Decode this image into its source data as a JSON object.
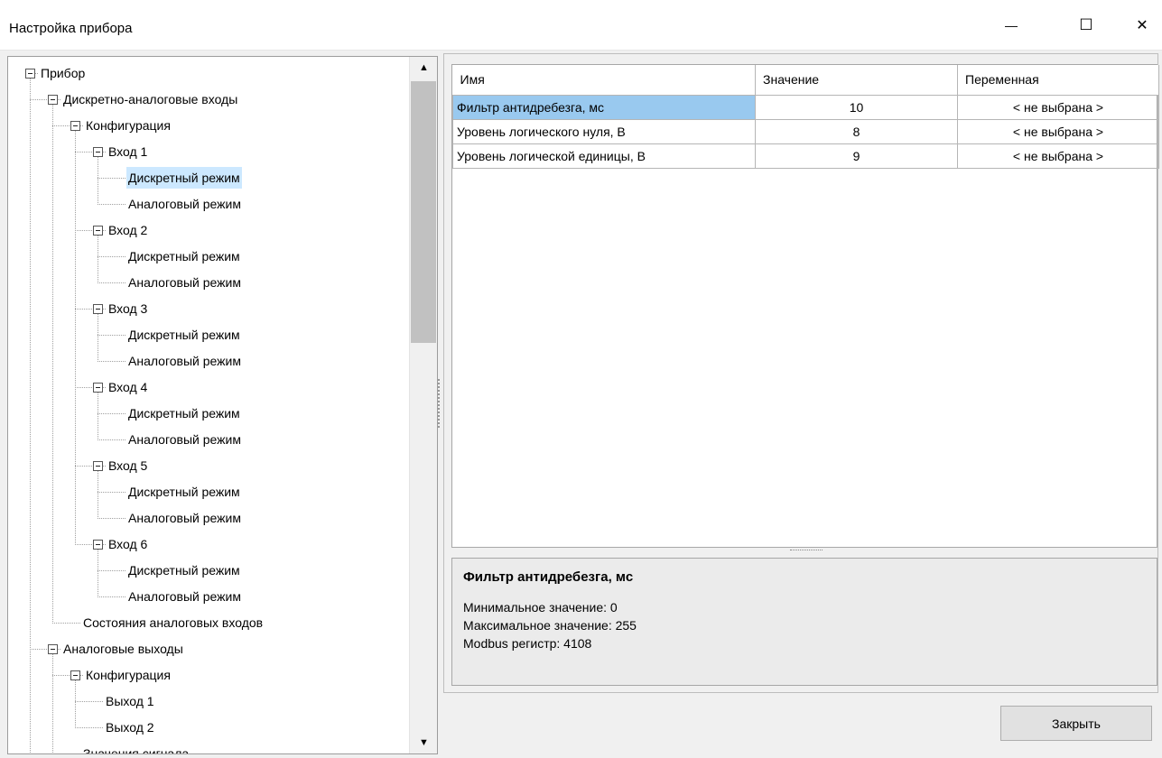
{
  "window": {
    "title": "Настройка прибора",
    "minimize_glyph": "—",
    "maximize_glyph": "☐",
    "close_glyph": "✕"
  },
  "tree": {
    "nodes": [
      {
        "label": "Прибор",
        "level": 0,
        "expanded": true
      },
      {
        "label": "Дискретно-аналоговые входы",
        "level": 1,
        "expanded": true
      },
      {
        "label": "Конфигурация",
        "level": 2,
        "expanded": true
      },
      {
        "label": "Вход 1",
        "level": 3,
        "expanded": true
      },
      {
        "label": "Дискретный режим",
        "level": 4,
        "selected": true
      },
      {
        "label": "Аналоговый режим",
        "level": 4
      },
      {
        "label": "Вход 2",
        "level": 3,
        "expanded": true
      },
      {
        "label": "Дискретный режим",
        "level": 4
      },
      {
        "label": "Аналоговый режим",
        "level": 4
      },
      {
        "label": "Вход 3",
        "level": 3,
        "expanded": true
      },
      {
        "label": "Дискретный режим",
        "level": 4
      },
      {
        "label": "Аналоговый режим",
        "level": 4
      },
      {
        "label": "Вход 4",
        "level": 3,
        "expanded": true
      },
      {
        "label": "Дискретный режим",
        "level": 4
      },
      {
        "label": "Аналоговый режим",
        "level": 4
      },
      {
        "label": "Вход 5",
        "level": 3,
        "expanded": true
      },
      {
        "label": "Дискретный режим",
        "level": 4
      },
      {
        "label": "Аналоговый режим",
        "level": 4
      },
      {
        "label": "Вход 6",
        "level": 3,
        "expanded": true
      },
      {
        "label": "Дискретный режим",
        "level": 4
      },
      {
        "label": "Аналоговый режим",
        "level": 4
      },
      {
        "label": "Состояния аналоговых входов",
        "level": 2
      },
      {
        "label": "Аналоговые выходы",
        "level": 1,
        "expanded": true
      },
      {
        "label": "Конфигурация",
        "level": 2,
        "expanded": true
      },
      {
        "label": "Выход 1",
        "level": 3
      },
      {
        "label": "Выход 2",
        "level": 3
      },
      {
        "label": "Значения сигнала",
        "level": 2
      }
    ],
    "scroll_up_glyph": "▲",
    "scroll_down_glyph": "▼"
  },
  "grid": {
    "columns": [
      "Имя",
      "Значение",
      "Переменная"
    ],
    "rows": [
      {
        "name": "Фильтр антидребезга, мс",
        "value": "10",
        "variable": "< не выбрана >"
      },
      {
        "name": "Уровень логического нуля, В",
        "value": "8",
        "variable": "< не выбрана >"
      },
      {
        "name": "Уровень логической единицы, В",
        "value": "9",
        "variable": "< не выбрана >"
      }
    ]
  },
  "description": {
    "title": "Фильтр антидребезга, мс",
    "lines": [
      "Минимальное значение: 0",
      "Максимальное значение: 255",
      "Modbus регистр: 4108"
    ]
  },
  "buttons": {
    "close_label": "Закрыть"
  },
  "colors": {
    "selection_tree": "#cce8ff",
    "selection_grid": "#99c9ef"
  }
}
